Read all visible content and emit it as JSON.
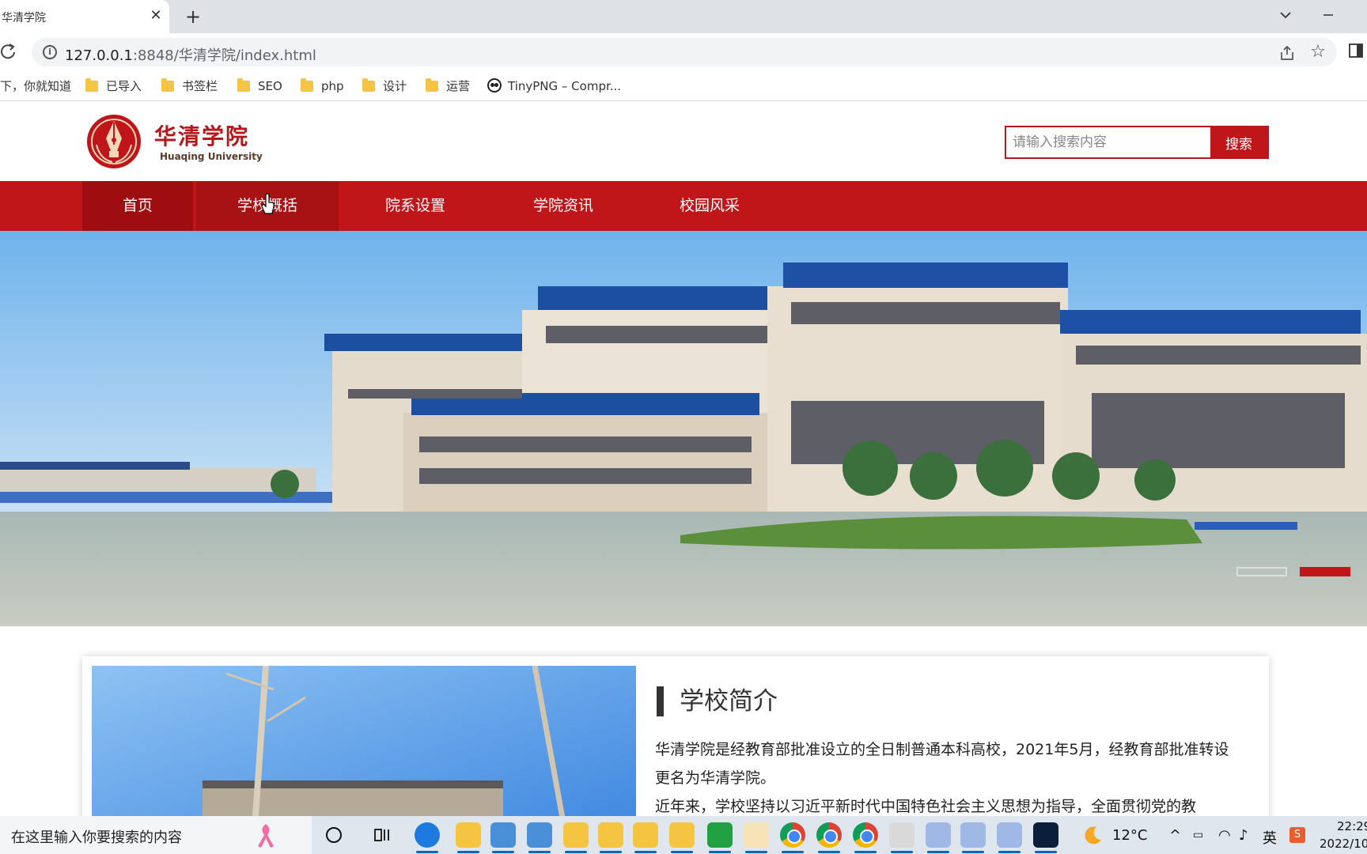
{
  "browser": {
    "tab_title": "华清学院",
    "url_host": "127.0.0.1",
    "url_path": ":8848/华清学院/index.html",
    "bookmarks": [
      {
        "label": "下，你就知道",
        "icon": "none"
      },
      {
        "label": "已导入",
        "icon": "folder-icon"
      },
      {
        "label": "书签栏",
        "icon": "folder-icon"
      },
      {
        "label": "SEO",
        "icon": "folder-icon"
      },
      {
        "label": "php",
        "icon": "folder-icon"
      },
      {
        "label": "设计",
        "icon": "folder-icon"
      },
      {
        "label": "运营",
        "icon": "folder-icon"
      },
      {
        "label": "TinyPNG – Compr...",
        "icon": "panda-icon"
      }
    ]
  },
  "site": {
    "logo_cn": "华清学院",
    "logo_en": "Huaqing University",
    "search_placeholder": "请输入搜索内容",
    "search_button": "搜索",
    "nav": [
      {
        "label": "首页",
        "state": "active"
      },
      {
        "label": "学校概括",
        "state": "hover"
      },
      {
        "label": "院系设置",
        "state": "normal"
      },
      {
        "label": "学院资讯",
        "state": "normal"
      },
      {
        "label": "校园风采",
        "state": "normal"
      }
    ],
    "banner_slides": 2,
    "banner_active_slide": 2,
    "intro": {
      "title": "学校简介",
      "paragraph1": "华清学院是经教育部批准设立的全日制普通本科高校，2021年5月，经教育部批准转设更名为华清学院。",
      "paragraph2": "近年来，学校坚持以习近平新时代中国特色社会主义思想为指导，全面贯彻党的教"
    },
    "colors": {
      "brand_red": "#c0161a",
      "nav_active": "#9e0d10"
    }
  },
  "taskbar": {
    "search_placeholder": "在这里输入你要搜索的内容",
    "weather_temp": "12°C",
    "ime_label": "英",
    "clock_time": "22:29",
    "clock_date": "2022/10"
  }
}
